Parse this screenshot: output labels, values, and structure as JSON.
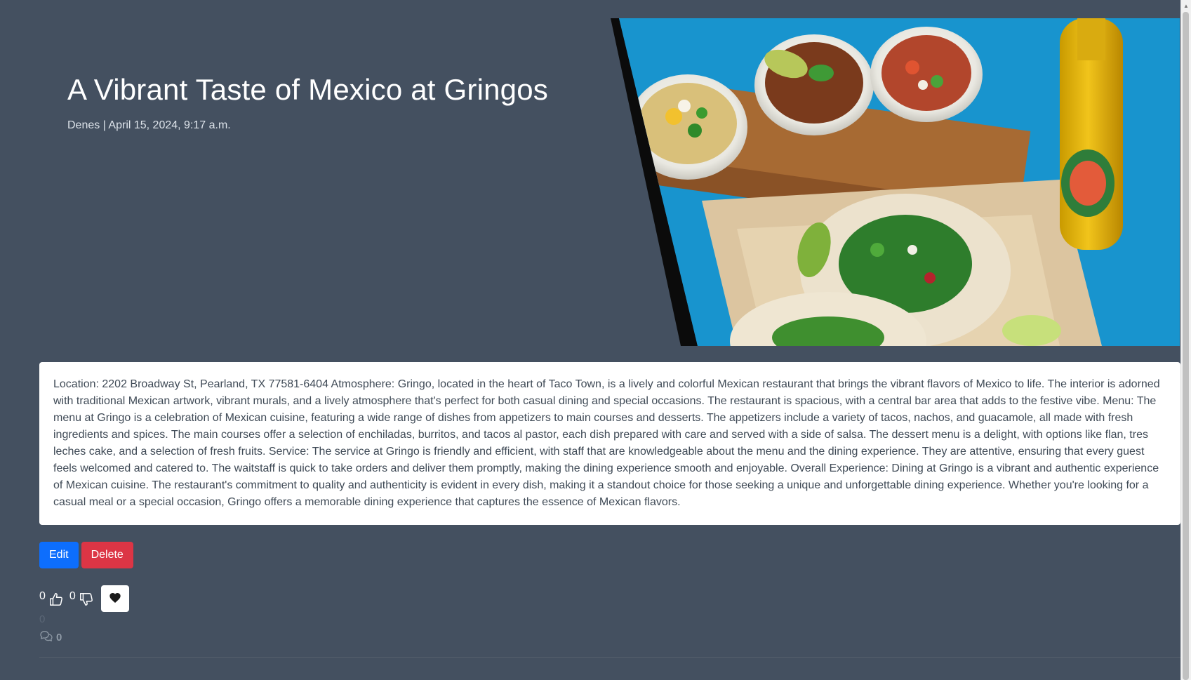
{
  "post": {
    "title": "A Vibrant Taste of Mexico at Gringos",
    "meta": "Denes | April 15, 2024, 9:17 a.m.",
    "body": "Location: 2202 Broadway St, Pearland, TX 77581-6404 Atmosphere: Gringo, located in the heart of Taco Town, is a lively and colorful Mexican restaurant that brings the vibrant flavors of Mexico to life. The interior is adorned with traditional Mexican artwork, vibrant murals, and a lively atmosphere that's perfect for both casual dining and special occasions. The restaurant is spacious, with a central bar area that adds to the festive vibe. Menu: The menu at Gringo is a celebration of Mexican cuisine, featuring a wide range of dishes from appetizers to main courses and desserts. The appetizers include a variety of tacos, nachos, and guacamole, all made with fresh ingredients and spices. The main courses offer a selection of enchiladas, burritos, and tacos al pastor, each dish prepared with care and served with a side of salsa. The dessert menu is a delight, with options like flan, tres leches cake, and a selection of fresh fruits. Service: The service at Gringo is friendly and efficient, with staff that are knowledgeable about the menu and the dining experience. They are attentive, ensuring that every guest feels welcomed and catered to. The waitstaff is quick to take orders and deliver them promptly, making the dining experience smooth and enjoyable. Overall Experience: Dining at Gringo is a vibrant and authentic experience of Mexican cuisine. The restaurant's commitment to quality and authenticity is evident in every dish, making it a standout choice for those seeking a unique and unforgettable dining experience. Whether you're looking for a casual meal or a special occasion, Gringo offers a memorable dining experience that captures the essence of Mexican flavors."
  },
  "actions": {
    "edit_label": "Edit",
    "delete_label": "Delete"
  },
  "reactions": {
    "likes": "0",
    "dislikes": "0",
    "favorites": "0",
    "comments": "0"
  },
  "icons": {
    "like": "thumbs-up-icon",
    "dislike": "thumbs-down-icon",
    "favorite": "heart-icon",
    "comments": "comments-icon"
  },
  "colors": {
    "background": "#445060",
    "edit_button": "#0d6efd",
    "delete_button": "#dc3545",
    "card": "#ffffff"
  }
}
